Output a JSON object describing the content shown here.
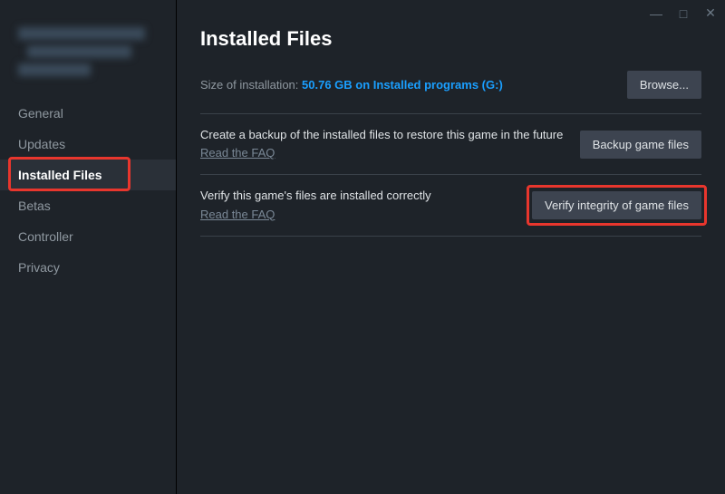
{
  "window_controls": {
    "minimize": "—",
    "maximize": "□",
    "close": "✕"
  },
  "sidebar": {
    "items": [
      {
        "label": "General"
      },
      {
        "label": "Updates"
      },
      {
        "label": "Installed Files"
      },
      {
        "label": "Betas"
      },
      {
        "label": "Controller"
      },
      {
        "label": "Privacy"
      }
    ]
  },
  "main": {
    "title": "Installed Files",
    "size_label": "Size of installation: ",
    "size_value": "50.76 GB on Installed programs (G:)",
    "browse_label": "Browse...",
    "backup": {
      "desc": "Create a backup of the installed files to restore this game in the future",
      "faq": "Read the FAQ",
      "button": "Backup game files"
    },
    "verify": {
      "desc": "Verify this game's files are installed correctly",
      "faq": "Read the FAQ",
      "button": "Verify integrity of game files"
    }
  }
}
